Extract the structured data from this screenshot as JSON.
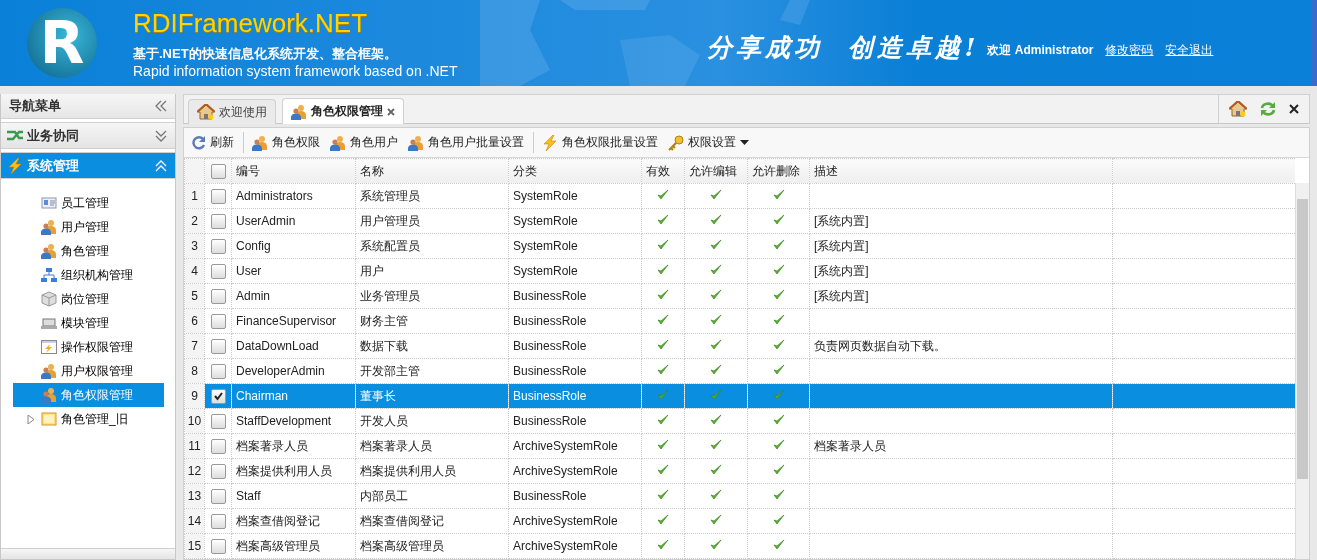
{
  "header": {
    "logo_letter": "R",
    "title": "RDIFramework.NET",
    "subtitle_cn": "基于.NET的快速信息化系统开发、整合框架。",
    "subtitle_en": "Rapid information system framework based on .NET",
    "slogan": "分享成功  创造卓越!",
    "welcome": "欢迎 Administrator",
    "links": [
      "修改密码",
      "安全退出"
    ]
  },
  "sidebar": {
    "title": "导航菜单",
    "panels": [
      {
        "label": "业务协同",
        "expanded": false
      },
      {
        "label": "系统管理",
        "expanded": true,
        "items": [
          {
            "label": "员工管理",
            "kind": "leaf",
            "selected": false
          },
          {
            "label": "用户管理",
            "kind": "leaf",
            "selected": false
          },
          {
            "label": "角色管理",
            "kind": "leaf",
            "selected": false
          },
          {
            "label": "组织机构管理",
            "kind": "leaf",
            "selected": false
          },
          {
            "label": "岗位管理",
            "kind": "leaf",
            "selected": false
          },
          {
            "label": "模块管理",
            "kind": "leaf",
            "selected": false
          },
          {
            "label": "操作权限管理",
            "kind": "leaf",
            "selected": false
          },
          {
            "label": "用户权限管理",
            "kind": "leaf",
            "selected": false
          },
          {
            "label": "角色权限管理",
            "kind": "leaf",
            "selected": true
          },
          {
            "label": "角色管理_旧",
            "kind": "folder",
            "selected": false,
            "expanded": false
          }
        ]
      }
    ]
  },
  "tabs": [
    {
      "label": "欢迎使用",
      "selected": false,
      "closable": false
    },
    {
      "label": "角色权限管理",
      "selected": true,
      "closable": true
    }
  ],
  "toolbar": [
    {
      "label": "刷新",
      "separator_before": false
    },
    {
      "label": "角色权限",
      "separator_before": true
    },
    {
      "label": "角色用户",
      "separator_before": false
    },
    {
      "label": "角色用户批量设置",
      "separator_before": false
    },
    {
      "label": "角色权限批量设置",
      "separator_before": true
    },
    {
      "label": "权限设置",
      "separator_before": false,
      "menu": true
    }
  ],
  "grid": {
    "all_checked": false,
    "columns": [
      "编号",
      "名称",
      "分类",
      "有效",
      "允许编辑",
      "允许删除",
      "描述"
    ],
    "rows": [
      {
        "num": "1",
        "checked": false,
        "selected": false,
        "code": "Administrators",
        "name": "系统管理员",
        "category": "SystemRole",
        "valid": true,
        "allow_edit": true,
        "allow_delete": true
      },
      {
        "num": "2",
        "checked": false,
        "selected": false,
        "code": "UserAdmin",
        "name": "用户管理员",
        "category": "SystemRole",
        "valid": true,
        "allow_edit": true,
        "allow_delete": true,
        "description": "[系统内置]"
      },
      {
        "num": "3",
        "checked": false,
        "selected": false,
        "code": "Config",
        "name": "系统配置员",
        "category": "SystemRole",
        "valid": true,
        "allow_edit": true,
        "allow_delete": true,
        "description": "[系统内置]"
      },
      {
        "num": "4",
        "checked": false,
        "selected": false,
        "code": "User",
        "name": "用户",
        "category": "SystemRole",
        "valid": true,
        "allow_edit": true,
        "allow_delete": true,
        "description": "[系统内置]"
      },
      {
        "num": "5",
        "checked": false,
        "selected": false,
        "code": "Admin",
        "name": "业务管理员",
        "category": "BusinessRole",
        "valid": true,
        "allow_edit": true,
        "allow_delete": true,
        "description": "[系统内置]"
      },
      {
        "num": "6",
        "checked": false,
        "selected": false,
        "code": "FinanceSupervisor",
        "name": "财务主管",
        "category": "BusinessRole",
        "valid": true,
        "allow_edit": true,
        "allow_delete": true
      },
      {
        "num": "7",
        "checked": false,
        "selected": false,
        "code": "DataDownLoad",
        "name": "数据下载",
        "category": "BusinessRole",
        "valid": true,
        "allow_edit": true,
        "allow_delete": true,
        "description": "负责网页数据自动下载。"
      },
      {
        "num": "8",
        "checked": false,
        "selected": false,
        "code": "DeveloperAdmin",
        "name": "开发部主管",
        "category": "BusinessRole",
        "valid": true,
        "allow_edit": true,
        "allow_delete": true
      },
      {
        "num": "9",
        "checked": true,
        "selected": true,
        "code": "Chairman",
        "name": "董事长",
        "category": "BusinessRole",
        "valid": true,
        "allow_edit": true,
        "allow_delete": true
      },
      {
        "num": "10",
        "checked": false,
        "selected": false,
        "code": "StaffDevelopment",
        "name": "开发人员",
        "category": "BusinessRole",
        "valid": true,
        "allow_edit": true,
        "allow_delete": true
      },
      {
        "num": "11",
        "checked": false,
        "selected": false,
        "code": "档案著录人员",
        "name": "档案著录人员",
        "category": "ArchiveSystemRole",
        "valid": true,
        "allow_edit": true,
        "allow_delete": true,
        "description": "档案著录人员"
      },
      {
        "num": "12",
        "checked": false,
        "selected": false,
        "code": "档案提供利用人员",
        "name": "档案提供利用人员",
        "category": "ArchiveSystemRole",
        "valid": true,
        "allow_edit": true,
        "allow_delete": true
      },
      {
        "num": "13",
        "checked": false,
        "selected": false,
        "code": "Staff",
        "name": "内部员工",
        "category": "BusinessRole",
        "valid": true,
        "allow_edit": true,
        "allow_delete": true
      },
      {
        "num": "14",
        "checked": false,
        "selected": false,
        "code": "档案查借阅登记",
        "name": "档案查借阅登记",
        "category": "ArchiveSystemRole",
        "valid": true,
        "allow_edit": true,
        "allow_delete": true
      },
      {
        "num": "15",
        "checked": false,
        "selected": false,
        "code": "档案高级管理员",
        "name": "档案高级管理员",
        "category": "ArchiveSystemRole",
        "valid": true,
        "allow_edit": true,
        "allow_delete": true
      }
    ]
  }
}
